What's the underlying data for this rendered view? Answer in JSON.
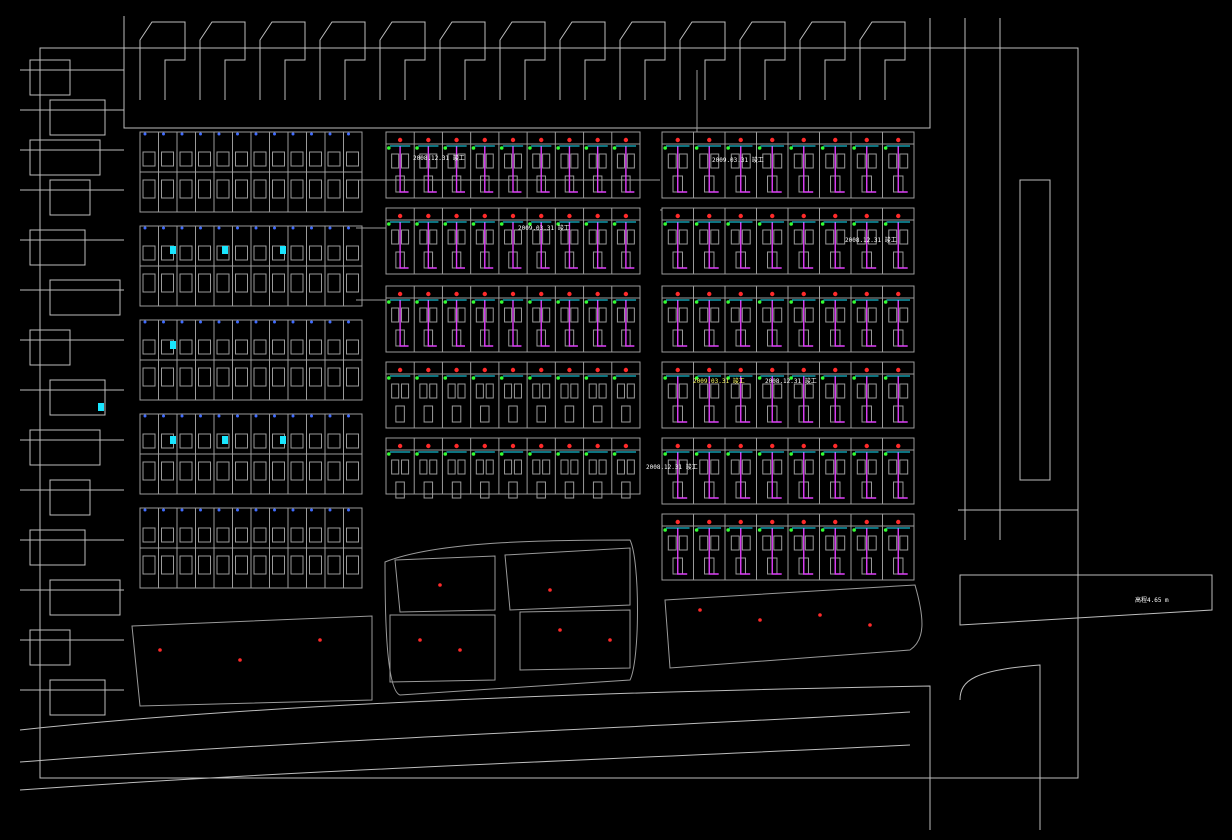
{
  "colors": {
    "background": "#000000",
    "linework": "#bdbdbd",
    "building": "#9a9a9a",
    "annotation_white": "#ffffff",
    "annotation_magenta": "#e040fb",
    "annotation_yellow": "#ffff66",
    "annotation_cyan": "#19e6ff",
    "marker_red": "#ff2a2a",
    "marker_green": "#33ff33",
    "marker_blue": "#3f6bff"
  },
  "annotations": [
    {
      "id": "a1",
      "text": "2008.12.31 竣工",
      "color": "annotation_white"
    },
    {
      "id": "a2",
      "text": "2009.03.31 竣工",
      "color": "annotation_white"
    },
    {
      "id": "a3",
      "text": "2009.03.31 竣工",
      "color": "annotation_white"
    },
    {
      "id": "a4",
      "text": "2008.12.31 竣工",
      "color": "annotation_white"
    },
    {
      "id": "a5",
      "text": "2009.03.31 竣工",
      "color": "annotation_yellow"
    },
    {
      "id": "a6",
      "text": "2008.12.31 竣工",
      "color": "annotation_white"
    },
    {
      "id": "a7",
      "text": "2008.12.31 竣工",
      "color": "annotation_white"
    },
    {
      "id": "a8",
      "text": "高程4.65 m",
      "color": "annotation_white"
    }
  ]
}
